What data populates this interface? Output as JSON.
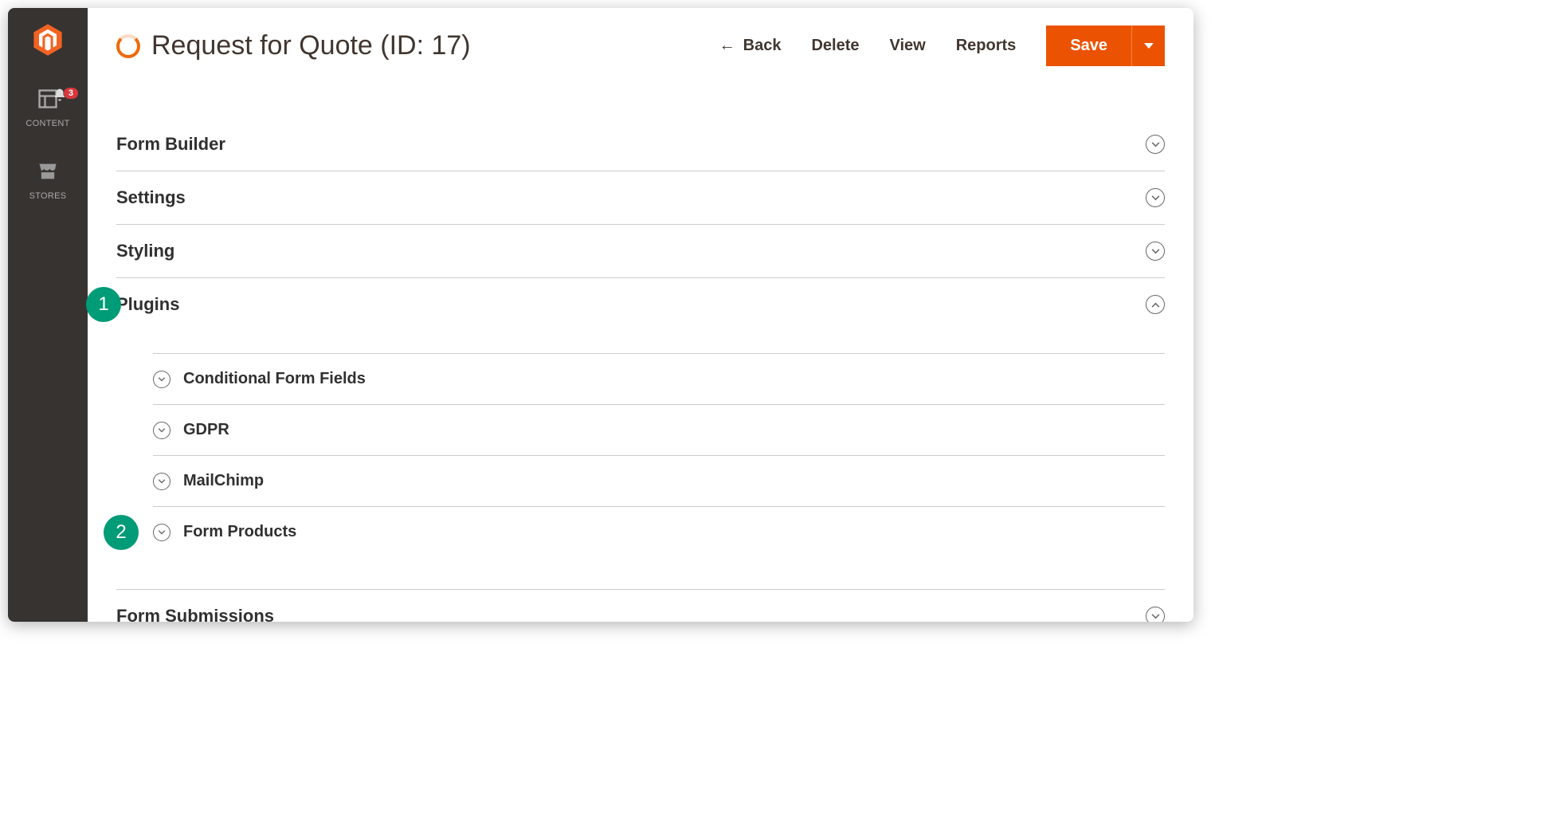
{
  "sidebar": {
    "items": [
      {
        "label": "CONTENT"
      },
      {
        "label": "STORES"
      }
    ],
    "notification_count": "3"
  },
  "header": {
    "title": "Request for Quote (ID: 17)",
    "actions": {
      "back": "Back",
      "delete": "Delete",
      "view": "View",
      "reports": "Reports",
      "save": "Save"
    }
  },
  "sections": {
    "form_builder": "Form Builder",
    "settings": "Settings",
    "styling": "Styling",
    "plugins": "Plugins",
    "form_submissions": "Form Submissions"
  },
  "plugins_sub": [
    {
      "label": "Conditional Form Fields"
    },
    {
      "label": "GDPR"
    },
    {
      "label": "MailChimp"
    },
    {
      "label": "Form Products"
    }
  ],
  "callouts": {
    "one": "1",
    "two": "2"
  }
}
